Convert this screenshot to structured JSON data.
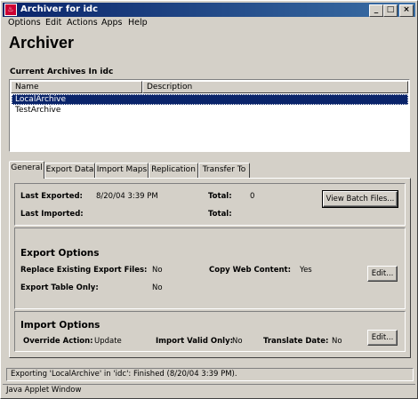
{
  "window": {
    "title": "Archiver for idc",
    "controls": {
      "minimize": "_",
      "maximize": "□",
      "close": "×"
    }
  },
  "menu": {
    "items": [
      "Options",
      "Edit",
      "Actions",
      "Apps",
      "Help"
    ]
  },
  "heading": "Archiver",
  "archives": {
    "label": "Current Archives In idc",
    "columns": [
      "Name",
      "Description"
    ],
    "rows": [
      {
        "name": "LocalArchive",
        "description": "",
        "selected": true
      },
      {
        "name": "TestArchive",
        "description": "",
        "selected": false
      }
    ]
  },
  "tabs": [
    {
      "label": "General",
      "active": true
    },
    {
      "label": "Export Data",
      "active": false
    },
    {
      "label": "Import Maps",
      "active": false
    },
    {
      "label": "Replication",
      "active": false
    },
    {
      "label": "Transfer To",
      "active": false
    }
  ],
  "general": {
    "last_exported_label": "Last Exported:",
    "last_exported_value": "8/20/04 3:39 PM",
    "total_label": "Total:",
    "total_exported_value": "0",
    "last_imported_label": "Last Imported:",
    "total_imported_label": "Total:",
    "view_batch_button": "View Batch Files..."
  },
  "export_options": {
    "title": "Export Options",
    "replace_label": "Replace Existing Export Files:",
    "replace_value": "No",
    "copy_web_label": "Copy Web Content:",
    "copy_web_value": "Yes",
    "table_only_label": "Export Table Only:",
    "table_only_value": "No",
    "edit_button": "Edit..."
  },
  "import_options": {
    "title": "Import Options",
    "override_label": "Override Action:",
    "override_value": "Update",
    "valid_only_label": "Import Valid Only:",
    "valid_only_value": "No",
    "translate_label": "Translate Date:",
    "translate_value": "No",
    "edit_button": "Edit..."
  },
  "status": "Exporting 'LocalArchive' in 'idc': Finished (8/20/04 3:39 PM).",
  "applet_label": "Java Applet Window",
  "colors": {
    "title_start": "#0a246a",
    "title_end": "#3a6ea5",
    "selection": "#0a246a",
    "face": "#d4d0c8"
  }
}
